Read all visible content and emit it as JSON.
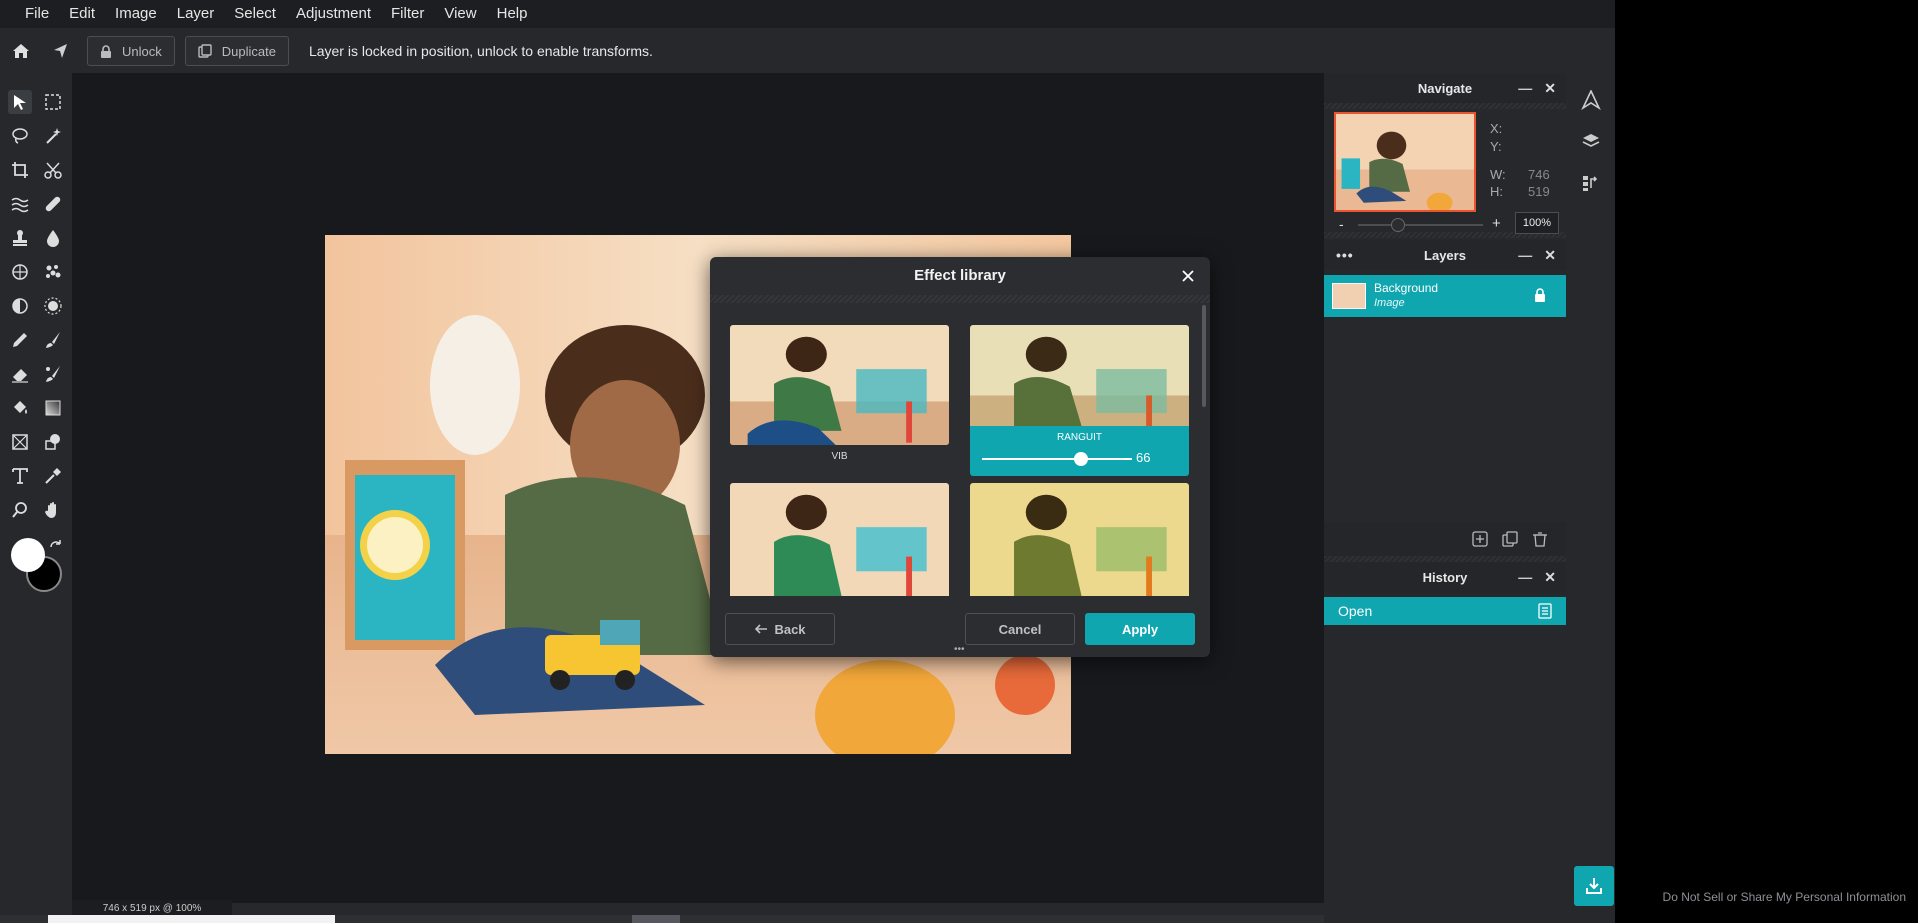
{
  "menu": [
    "File",
    "Edit",
    "Image",
    "Layer",
    "Select",
    "Adjustment",
    "Filter",
    "View",
    "Help"
  ],
  "options": {
    "unlock_label": "Unlock",
    "duplicate_label": "Duplicate",
    "message": "Layer is locked in position, unlock to enable transforms."
  },
  "status": "746 x 519 px @ 100%",
  "navigate": {
    "title": "Navigate",
    "x_label": "X:",
    "y_label": "Y:",
    "w_label": "W:",
    "w_value": "746",
    "h_label": "H:",
    "h_value": "519",
    "zoom_minus": "-",
    "zoom_plus": "+",
    "zoom_value": "100%"
  },
  "layers": {
    "title": "Layers",
    "items": [
      {
        "name": "Background",
        "type": "Image"
      }
    ]
  },
  "history": {
    "title": "History",
    "items": [
      {
        "label": "Open"
      }
    ]
  },
  "dialog": {
    "title": "Effect library",
    "effects": [
      {
        "name": "VIB"
      },
      {
        "name": "RANGUIT",
        "value": "66",
        "level": 0.66
      }
    ],
    "back_label": "Back",
    "cancel_label": "Cancel",
    "apply_label": "Apply"
  },
  "footer_link": "Do Not Sell or Share My Personal Information",
  "colors": {
    "accent": "#10a6b0",
    "app_bg": "#26282c",
    "canvas_bg": "#18191c",
    "menubar_bg": "#1d1e21"
  }
}
